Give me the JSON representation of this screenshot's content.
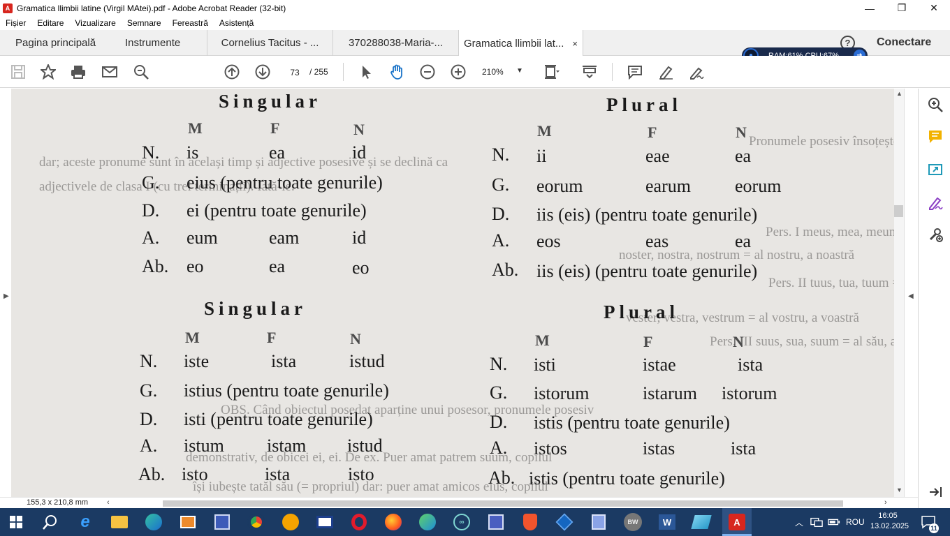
{
  "window": {
    "title": "Gramatica llimbii latine (Virgil MAtei).pdf - Adobe Acrobat Reader (32-bit)",
    "controls": [
      "—",
      "❐",
      "✕"
    ]
  },
  "menu": [
    "Fișier",
    "Editare",
    "Vizualizare",
    "Semnare",
    "Fereastră",
    "Asistență"
  ],
  "tabs": {
    "home": "Pagina principală",
    "tools": "Instrumente",
    "docs": [
      "Cornelius Tacitus - ...",
      "370288038-Maria-...",
      "Gramatica llimbii lat..."
    ],
    "close_glyph": "×"
  },
  "header_right": {
    "help": "?",
    "connect": "Conectare"
  },
  "perf_widget": {
    "text": "RAM:61%  CPU:67%"
  },
  "toolbar": {
    "page_current": "73",
    "page_total": "/ 255",
    "zoom": "210%"
  },
  "status": {
    "page_size": "155,3 x 210,8 mm"
  },
  "icons": [
    "save-icon",
    "star-icon",
    "print-icon",
    "mail-icon",
    "search-zoom-icon",
    "page-up-icon",
    "page-down-icon",
    "select-cursor-icon",
    "hand-icon",
    "zoom-out-icon",
    "zoom-in-icon",
    "page-fit-icon",
    "scroll-mode-icon",
    "comment-icon",
    "highlight-icon",
    "sign-icon",
    "zoom-side-icon",
    "note-side-icon",
    "export-side-icon",
    "edit-side-icon",
    "tools-side-icon"
  ],
  "document": {
    "block1": {
      "singular": "Singular",
      "plural": "Plural",
      "genders_s": [
        "M",
        "F",
        "N"
      ],
      "genders_p": [
        "M",
        "F",
        "N"
      ],
      "n_label": "N.",
      "n_s": [
        "is",
        "ea",
        "id"
      ],
      "n_p_label": "N.",
      "n_p": [
        "ii",
        "eae",
        "ea"
      ],
      "g_label": "G.",
      "g_s": "eius (pentru toate genurile)",
      "g_p_label": "G.",
      "g_p": [
        "eorum",
        "earum",
        "eorum"
      ],
      "d_label": "D.",
      "d_s": "ei (pentru toate genurile)",
      "d_p_label": "D.",
      "d_p": "iis (eis) (pentru toate genurile)",
      "a_label": "A.",
      "a_s": [
        "eum",
        "eam",
        "id"
      ],
      "a_p_label": "A.",
      "a_p": [
        "eos",
        "eas",
        "ea"
      ],
      "ab_label": "Ab.",
      "ab_s": [
        "eo",
        "ea",
        "eo"
      ],
      "ab_p_label": "Ab.",
      "ab_p": "iis (eis) (pentru toate genurile)"
    },
    "block2": {
      "singular": "Singular",
      "plural": "Plural",
      "genders_s": [
        "M",
        "F",
        "N"
      ],
      "genders_p": [
        "M",
        "F",
        "N"
      ],
      "n_label": "N.",
      "n_s": [
        "iste",
        "ista",
        "istud"
      ],
      "n_p_label": "N.",
      "n_p": [
        "isti",
        "istae",
        "ista"
      ],
      "g_label": "G.",
      "g_s": "istius (pentru toate genurile)",
      "g_p_label": "G.",
      "g_p": [
        "istorum",
        "istarum",
        "istorum"
      ],
      "d_label": "D.",
      "d_s": "isti (pentru toate genurile)",
      "d_p_label": "D.",
      "d_p": "istis (pentru toate genurile)",
      "a_label": "A.",
      "a_s": [
        "istum",
        "istam",
        "istud"
      ],
      "a_p_label": "A.",
      "a_p": [
        "istos",
        "istas",
        "ista"
      ],
      "ab_label": "Ab.",
      "ab_s": [
        "isto",
        "ista",
        "isto"
      ],
      "ab_p_label": "Ab.",
      "ab_p": "istis (pentru toate genurile)"
    },
    "bleed": [
      "Pronumele posesiv însoțește numele posesorului sau al obiectului posedat;",
      "dar; aceste pronume sunt în același timp și adjective posesive și se declină ca",
      "adjectivele de clasa I (cu trei terminații). Iată-le:",
      "Pers. I   meus, mea, meum  =  al meu, a mea",
      "noster, nostra, nostrum  =  al nostru, a noastră",
      "Pers. II   tuus, tua, tuum  =  al tău, a ta",
      "vester, vestra, vestrum  =  al vostru, a voastră",
      "Pers. III   suus, sua, suum  =  al său, a sa",
      "OBS. Când obiectul posedat aparține unui posesor, pronumele posesiv",
      "demonstrativ, de obicei ei, ei. De ex. Puer amat patrem suum, copilul",
      "își iubește tatăl său (= propriul) dar: puer amat amicos eius, copilul"
    ]
  },
  "taskbar": {
    "lang": "ROU",
    "time": "16:05",
    "date": "13.02.2025",
    "notif_count": "11",
    "apps": [
      "start",
      "search",
      "ie",
      "explorer",
      "edge",
      "media",
      "save",
      "chrome",
      "sun",
      "video",
      "opera",
      "firefox",
      "globe",
      "arduino",
      "floppy",
      "brave",
      "vs",
      "box",
      "bw",
      "word",
      "folder",
      "acrobat"
    ]
  }
}
